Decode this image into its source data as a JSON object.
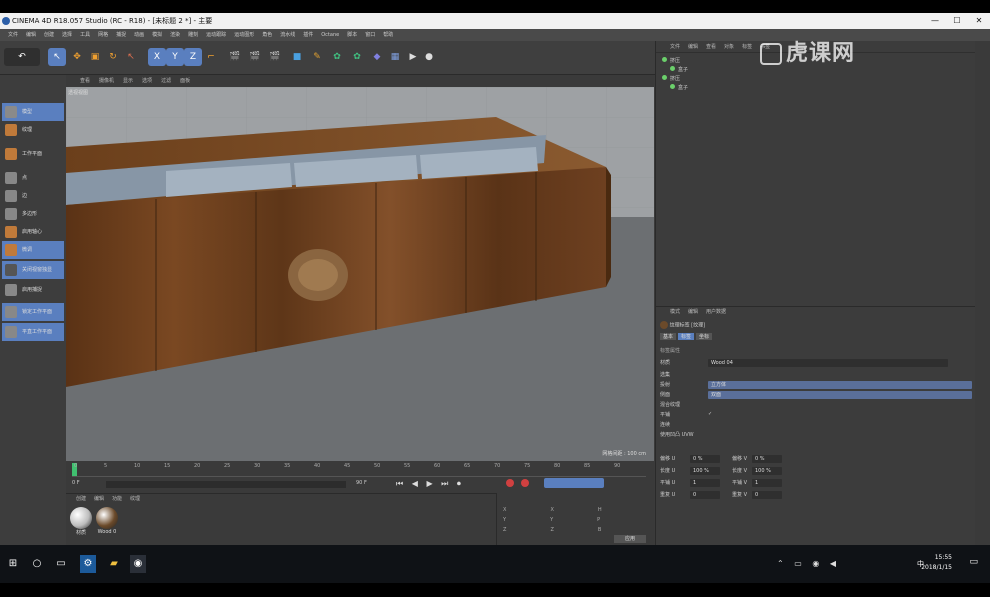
{
  "window": {
    "title": "CINEMA 4D R18.057 Studio (RC - R18) - [未标题 2 *] - 主要",
    "min": "—",
    "max": "☐",
    "close": "✕"
  },
  "menubar": [
    "文件",
    "编辑",
    "创建",
    "选择",
    "工具",
    "网格",
    "捕捉",
    "动画",
    "模拟",
    "渲染",
    "雕刻",
    "运动跟踪",
    "运动图形",
    "角色",
    "流水线",
    "插件",
    "Octane",
    "脚本",
    "窗口",
    "帮助"
  ],
  "left_tools": [
    {
      "label": "模型",
      "active": true,
      "color": "#8a8a8a"
    },
    {
      "label": "纹理",
      "active": false,
      "color": "#c07a3a"
    },
    {
      "label": "工作平面",
      "active": false,
      "color": "#c07a3a"
    },
    {
      "label": "点",
      "active": false,
      "color": "#888"
    },
    {
      "label": "边",
      "active": false,
      "color": "#888"
    },
    {
      "label": "多边形",
      "active": false,
      "color": "#888"
    },
    {
      "label": "启用轴心",
      "active": false,
      "color": "#c07a3a"
    },
    {
      "label": "微调",
      "active": true,
      "color": "#c07a3a"
    },
    {
      "label": "关闭视窗独显",
      "active": true,
      "color": "#555"
    },
    {
      "label": "启用捕捉",
      "active": false,
      "color": "#888"
    },
    {
      "label": "锁定工作平面",
      "active": true,
      "color": "#888"
    },
    {
      "label": "平直工作平面",
      "active": true,
      "color": "#888"
    }
  ],
  "viewport": {
    "menu": [
      "查看",
      "摄像机",
      "显示",
      "选项",
      "过滤",
      "面板"
    ],
    "label": "透视视图",
    "status": "网格间距 : 100 cm"
  },
  "timeline": {
    "ticks": [
      "0",
      "5",
      "10",
      "15",
      "20",
      "25",
      "30",
      "35",
      "40",
      "45",
      "50",
      "55",
      "60",
      "65",
      "70",
      "75",
      "80",
      "85",
      "90"
    ],
    "frame_current": "0 F",
    "start": "0 F",
    "end": "90 F"
  },
  "materials": {
    "menu": [
      "创建",
      "编辑",
      "功能",
      "纹理"
    ],
    "items": [
      {
        "label": "材质",
        "color": "#bdbdbd"
      },
      {
        "label": "Wood 0",
        "color": "#6b4a2a"
      }
    ]
  },
  "coords": {
    "rows": [
      [
        "X",
        "X",
        "H"
      ],
      [
        "Y",
        "Y",
        "P"
      ],
      [
        "Z",
        "Z",
        "B"
      ]
    ],
    "apply": "应用"
  },
  "object_manager": {
    "menu": [
      "文件",
      "编辑",
      "查看",
      "对象",
      "标签",
      "书签"
    ],
    "objects": [
      "挤压",
      "盒子",
      "挤压",
      "盒子"
    ]
  },
  "attribute_manager": {
    "menu": [
      "模式",
      "编辑",
      "用户数据"
    ],
    "title": "纹理标签 [纹理]",
    "tabs": [
      {
        "label": "基本",
        "on": false
      },
      {
        "label": "标签",
        "on": true
      },
      {
        "label": "坐标",
        "on": false
      }
    ],
    "section": "标签属性",
    "material_label": "材质",
    "material_value": "Wood 04",
    "rows": [
      {
        "label": "选集",
        "value": ""
      },
      {
        "label": "投射",
        "value": "立方体"
      },
      {
        "label": "侧面",
        "value": "双面"
      },
      {
        "label": "混合纹理",
        "value": ""
      },
      {
        "label": "平铺",
        "value": "✓"
      },
      {
        "label": "连续",
        "value": ""
      },
      {
        "label": "使用凹凸 UVW",
        "value": ""
      }
    ],
    "numeric": [
      {
        "l": "偏移 U",
        "v": "0 %",
        "l2": "偏移 V",
        "v2": "0 %"
      },
      {
        "l": "长度 U",
        "v": "100 %",
        "l2": "长度 V",
        "v2": "100 %"
      },
      {
        "l": "平铺 U",
        "v": "1",
        "l2": "平铺 V",
        "v2": "1"
      },
      {
        "l": "重复 U",
        "v": "0",
        "l2": "重复 V",
        "v2": "0"
      }
    ]
  },
  "taskbar": {
    "time": "15:55",
    "date": "2018/1/15",
    "ime": "中"
  },
  "watermark": "虎课网"
}
